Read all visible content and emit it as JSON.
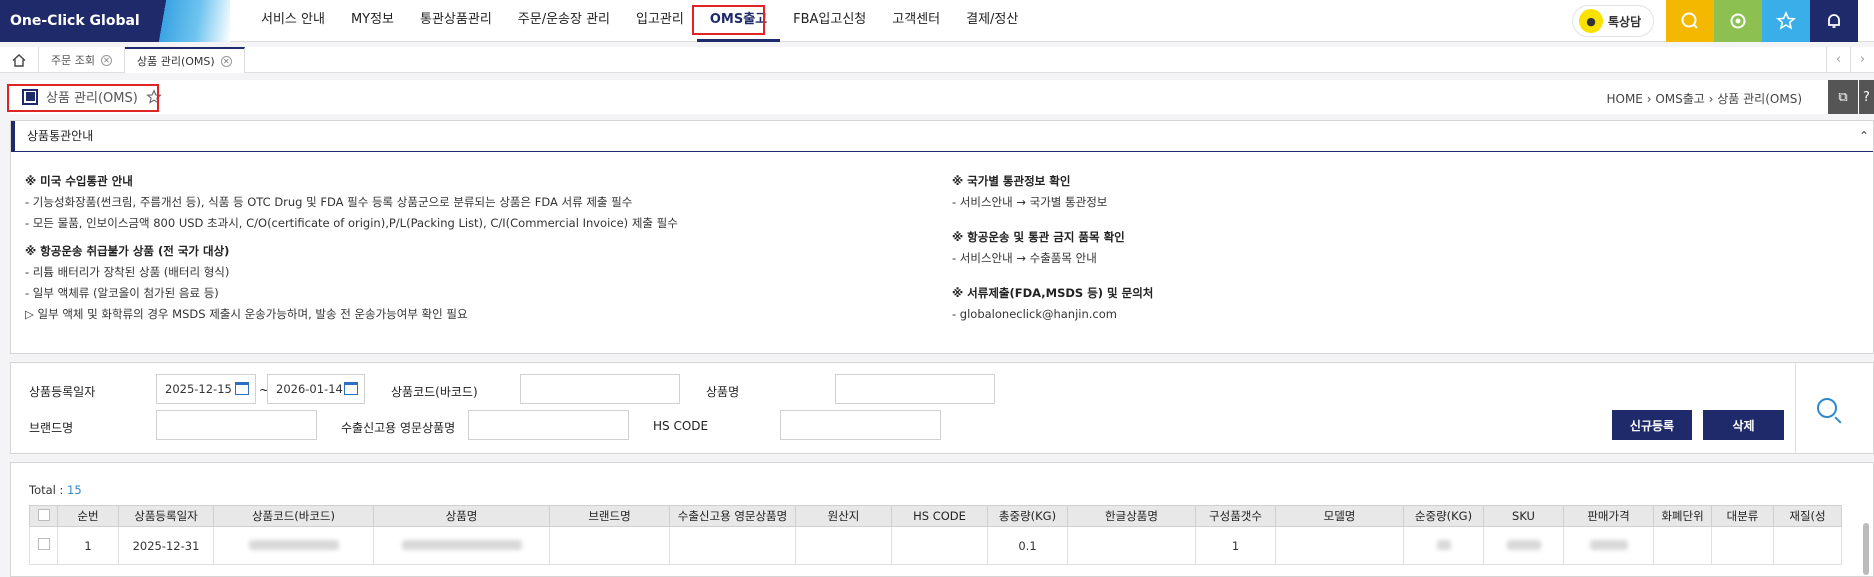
{
  "header": {
    "logo": "One-Click Global",
    "menu": [
      "서비스 안내",
      "MY정보",
      "통관상품관리",
      "주문/운송장 관리",
      "입고관리",
      "OMS출고",
      "FBA입고신청",
      "고객센터",
      "결제/정산"
    ],
    "active_menu": "OMS출고",
    "kakao_label": "톡상담",
    "quick_buttons": [
      {
        "icon": "search-chat-icon",
        "color": "#f5b800"
      },
      {
        "icon": "settings-icon",
        "color": "#8cc152"
      },
      {
        "icon": "star-icon",
        "color": "#3aaee8"
      },
      {
        "icon": "bell-icon",
        "color": "#1f2a6b"
      }
    ]
  },
  "tabs": [
    {
      "label": "",
      "icon": "home-icon"
    },
    {
      "label": "주문 조회"
    },
    {
      "label": "상품 관리(OMS)",
      "active": true
    }
  ],
  "page": {
    "title": "상품 관리(OMS)",
    "breadcrumb": "HOME  ›  OMS출고  ›  상품 관리(OMS)"
  },
  "guide": {
    "title": "상품통관안내",
    "toggle": "⌃",
    "left": [
      {
        "heading": "※ 미국 수입통관 안내",
        "lines": [
          "- 기능성화장품(썬크림, 주름개선 등), 식품 등 OTC Drug 및 FDA 필수 등록 상품군으로 분류되는 상품은 FDA 서류 제출 필수",
          "- 모든 물품, 인보이스금액 800 USD 초과시, C/O(certificate of origin),P/L(Packing List), C/I(Commercial Invoice) 제출 필수"
        ]
      },
      {
        "heading": "※ 항공운송 취급불가 상품 (전 국가 대상)",
        "lines": [
          "- 리튬 배터리가 장착된 상품 (배터리 형식)",
          "- 일부 액체류 (알코올이 첨가된 음료 등)",
          "▷ 일부 액체 및 화학류의 경우 MSDS 제출시 운송가능하며, 발송 전 운송가능여부 확인 필요"
        ]
      }
    ],
    "right": [
      {
        "heading": "※ 국가별 통관정보 확인",
        "lines": [
          "- 서비스안내 → 국가별 통관정보"
        ]
      },
      {
        "heading": "※ 항공운송 및 통관 금지 품목 확인",
        "lines": [
          "- 서비스안내 → 수출품목 안내"
        ]
      },
      {
        "heading": "※ 서류제출(FDA,MSDS 등) 및 문의처",
        "lines": [
          "- globaloneclick@hanjin.com"
        ]
      }
    ]
  },
  "search": {
    "reg_date_label": "상품등록일자",
    "date_from": "2025-12-15",
    "date_sep": "~",
    "date_to": "2026-01-14",
    "code_label": "상품코드(바코드)",
    "name_label": "상품명",
    "brand_label": "브랜드명",
    "export_name_label": "수출신고용 영문상품명",
    "hs_label": "HS CODE",
    "new_button": "신규등록",
    "delete_button": "삭제"
  },
  "list": {
    "total_label": "Total : ",
    "total_count": "15",
    "columns": [
      "",
      "순번",
      "상품등록일자",
      "상품코드(바코드)",
      "상품명",
      "브랜드명",
      "수출신고용 영문상품명",
      "원산지",
      "HS CODE",
      "총중량(KG)",
      "한글상품명",
      "구성품갯수",
      "모델명",
      "순중량(KG)",
      "SKU",
      "판매가격",
      "화폐단위",
      "대분류",
      "재질(성"
    ],
    "rows": [
      {
        "no": "1",
        "date": "2025-12-31",
        "weight": "0.1",
        "components": "1"
      }
    ]
  }
}
